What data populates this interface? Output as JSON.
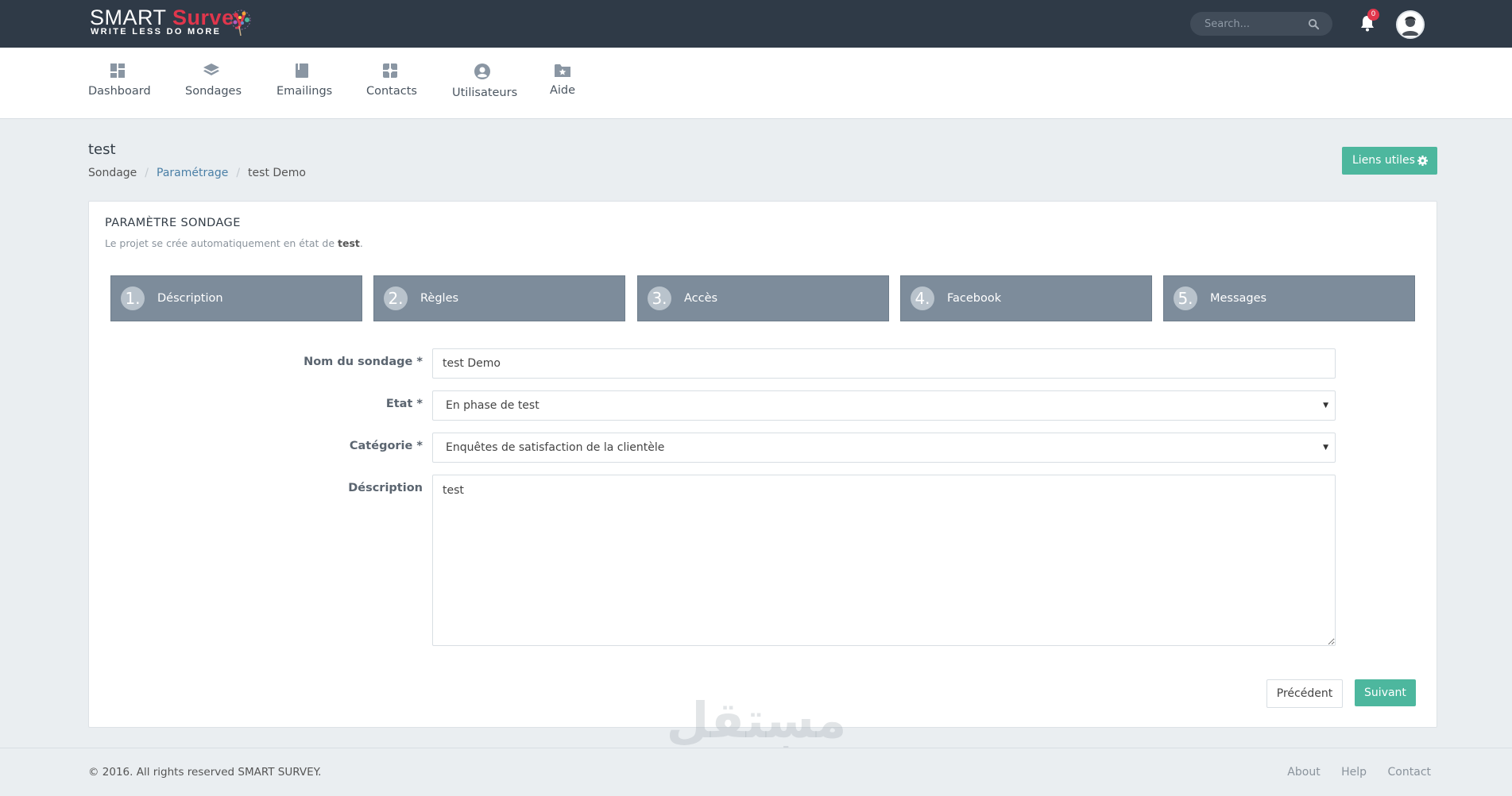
{
  "brand": {
    "name_part1": "SMART",
    "name_part2": "Survey",
    "tagline": "WRITE LESS DO MORE",
    "accent_color": "#e0364c"
  },
  "topbar": {
    "search_placeholder": "Search...",
    "notification_count": "0",
    "icons": [
      "search-icon",
      "bell-icon",
      "avatar"
    ]
  },
  "nav": {
    "items": [
      {
        "label": "Dashboard",
        "icon": "dashboard-icon"
      },
      {
        "label": "Sondages",
        "icon": "layers-icon"
      },
      {
        "label": "Emailings",
        "icon": "book-icon"
      },
      {
        "label": "Contacts",
        "icon": "contacts-icon"
      },
      {
        "label": "Utilisateurs",
        "icon": "user-circle-icon"
      },
      {
        "label": "Aide",
        "icon": "folder-star-icon"
      }
    ]
  },
  "page": {
    "title": "test",
    "breadcrumb": [
      "Sondage",
      "Paramétrage",
      "test Demo"
    ],
    "useful_links_label": "Liens utiles"
  },
  "card": {
    "title": "PARAMÈTRE SONDAGE",
    "subtitle_prefix": "Le projet se crée automatiquement en état de ",
    "subtitle_bold": "test",
    "subtitle_suffix": ".",
    "steps": [
      {
        "num": "1.",
        "label": "Déscription"
      },
      {
        "num": "2.",
        "label": "Règles"
      },
      {
        "num": "3.",
        "label": "Accès"
      },
      {
        "num": "4.",
        "label": "Facebook"
      },
      {
        "num": "5.",
        "label": "Messages"
      }
    ],
    "form": {
      "name_label": "Nom du sondage *",
      "name_value": "test Demo",
      "state_label": "Etat *",
      "state_value": "En phase de test",
      "category_label": "Catégorie *",
      "category_value": "Enquêtes de satisfaction de la clientèle",
      "description_label": "Déscription",
      "description_value": "test"
    },
    "prev_label": "Précédent",
    "next_label": "Suivant"
  },
  "footer": {
    "copyright": "© 2016. All rights reserved SMART SURVEY.",
    "links": [
      "About",
      "Help",
      "Contact"
    ]
  },
  "watermark": {
    "arabic": "مستقل",
    "latin": "mostaql.com"
  },
  "colors": {
    "topbar": "#2f3a47",
    "accent_green": "#4db79e",
    "step_bg": "#7d8c9b",
    "page_bg": "#eaeef1"
  }
}
